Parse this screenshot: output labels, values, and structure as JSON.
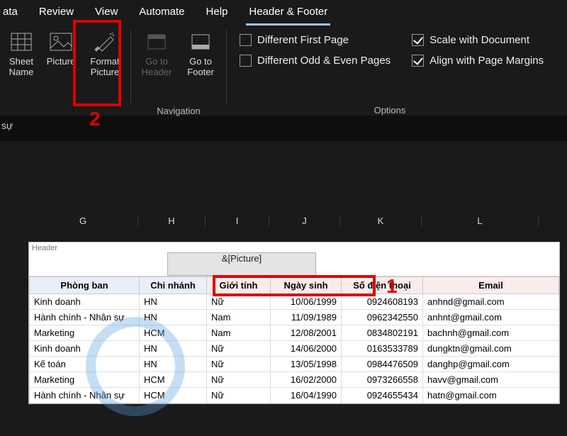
{
  "annotations": {
    "num1": "1",
    "num2": "2"
  },
  "tabs": {
    "data": "ata",
    "review": "Review",
    "view": "View",
    "automate": "Automate",
    "help": "Help",
    "header_footer": "Header & Footer"
  },
  "ribbon": {
    "sheet_name": {
      "l1": "Sheet",
      "l2": "Name"
    },
    "picture": "Picture",
    "format_picture": {
      "l1": "Format",
      "l2": "Picture"
    },
    "go_to_header": {
      "l1": "Go to",
      "l2": "Header"
    },
    "go_to_footer": {
      "l1": "Go to",
      "l2": "Footer"
    },
    "group_nav": "Navigation",
    "diff_first": "Different First Page",
    "diff_oddeven": "Different Odd & Even Pages",
    "scale_doc": "Scale with Document",
    "align_margins": "Align with Page Margins",
    "group_options": "Options"
  },
  "darkbar_text": "sự",
  "columns": {
    "G": "G",
    "H": "H",
    "I": "I",
    "J": "J",
    "K": "K",
    "L": "L"
  },
  "header_label": "Header",
  "header_center_value": "&[Picture]",
  "table": {
    "headers": {
      "dept": "Phòng ban",
      "branch": "Chi nhánh",
      "gender": "Giới tính",
      "dob": "Ngày sinh",
      "phone": "Số điện thoại",
      "email": "Email"
    },
    "rows": [
      {
        "dept": "Kinh doanh",
        "branch": "HN",
        "gender": "Nữ",
        "dob": "10/06/1999",
        "phone": "0924608193",
        "email": "anhnd@gmail.com"
      },
      {
        "dept": "Hành chính - Nhân sự",
        "branch": "HN",
        "gender": "Nam",
        "dob": "11/09/1989",
        "phone": "0962342550",
        "email": "anhnt@gmail.com"
      },
      {
        "dept": "Marketing",
        "branch": "HCM",
        "gender": "Nam",
        "dob": "12/08/2001",
        "phone": "0834802191",
        "email": "bachnh@gmail.com"
      },
      {
        "dept": "Kinh doanh",
        "branch": "HN",
        "gender": "Nữ",
        "dob": "14/06/2000",
        "phone": "0163533789",
        "email": "dungktn@gmail.com"
      },
      {
        "dept": "Kế toán",
        "branch": "HN",
        "gender": "Nữ",
        "dob": "13/05/1998",
        "phone": "0984476509",
        "email": "danghp@gmail.com"
      },
      {
        "dept": "Marketing",
        "branch": "HCM",
        "gender": "Nữ",
        "dob": "16/02/2000",
        "phone": "0973266558",
        "email": "havv@gmail.com"
      },
      {
        "dept": "Hành chính - Nhân sự",
        "branch": "HCM",
        "gender": "Nữ",
        "dob": "16/04/1990",
        "phone": "0924655434",
        "email": "hatn@gmail.com"
      }
    ]
  }
}
